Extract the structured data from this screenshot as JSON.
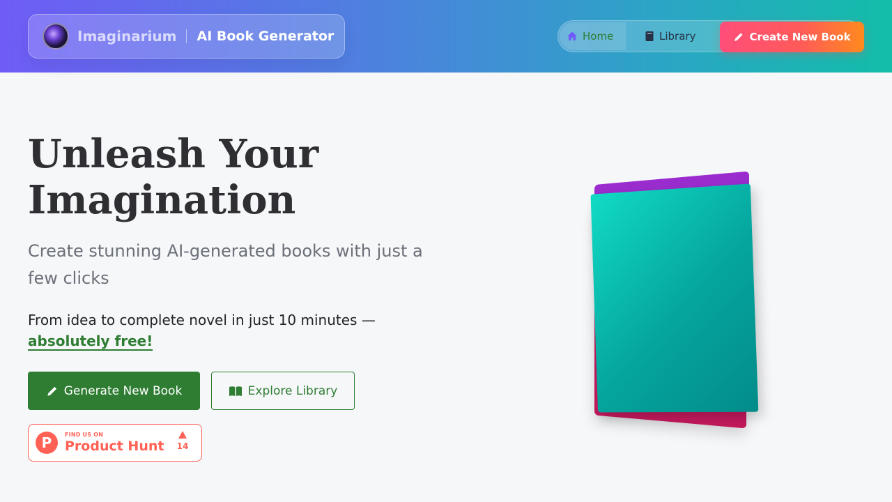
{
  "brand": {
    "name": "Imaginarium",
    "tagline": "AI Book Generator"
  },
  "nav": {
    "home_label": "Home",
    "library_label": "Library",
    "create_label": "Create New Book"
  },
  "hero": {
    "title_line1": "Unleash Your",
    "title_line2": "Imagination",
    "subtitle": "Create stunning AI-generated books with just a few clicks",
    "tagline_prefix": "From idea to complete novel in just 10 minutes —",
    "tagline_highlight": "absolutely free!"
  },
  "buttons": {
    "generate_label": "Generate New Book",
    "explore_label": "Explore Library"
  },
  "product_hunt": {
    "small_label": "FIND US ON",
    "big_label": "Product Hunt",
    "logo_letter": "P",
    "votes": "14"
  },
  "colors": {
    "brand_green": "#2e7d32",
    "accent_orange": "#ff8a1e",
    "accent_pink": "#ff4e7a",
    "product_hunt": "#ff6154"
  }
}
